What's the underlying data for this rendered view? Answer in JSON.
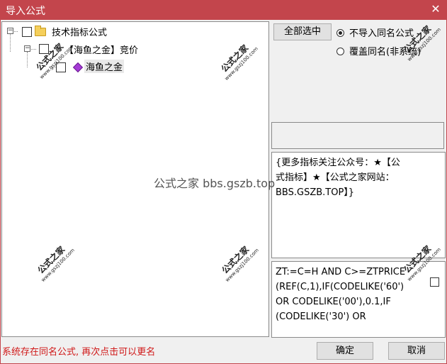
{
  "window": {
    "title": "导入公式",
    "close_glyph": "✕"
  },
  "tree": {
    "root": {
      "label": "技术指标公式",
      "expander": "−",
      "icon": "folder-icon"
    },
    "group": {
      "label": "【海鱼之金】竞价",
      "expander": "−"
    },
    "leaf": {
      "label": "海鱼之金",
      "icon": "formula-gem-icon"
    }
  },
  "options": {
    "select_all_label": "全部选中",
    "radio_no_import_label": "不导入同名公式",
    "radio_overwrite_label": "覆盖同名(非系统)",
    "selected": "no_import"
  },
  "description_text": "{更多指标关注公众号：★【公\n式指标】★【公式之家网站：\nBBS.GSZB.TOP】}",
  "code_text": "ZT:=C=H AND C>=ZTPRICE\n(REF(C,1),IF(CODELIKE('60')\nOR CODELIKE('00'),0.1,IF\n(CODELIKE('30') OR",
  "watermark": {
    "cn": "公式之家",
    "url": "www.gszj100.com",
    "center": "公式之家 bbs.gszb.top"
  },
  "status_text": "系统存在同名公式, 再次点击可以更名",
  "buttons": {
    "ok": "确定",
    "cancel": "取消"
  },
  "colors": {
    "titlebar": "#c3454c",
    "status_text": "#d01818",
    "folder": "#f5cf5b",
    "gem": "#a53bd6"
  }
}
